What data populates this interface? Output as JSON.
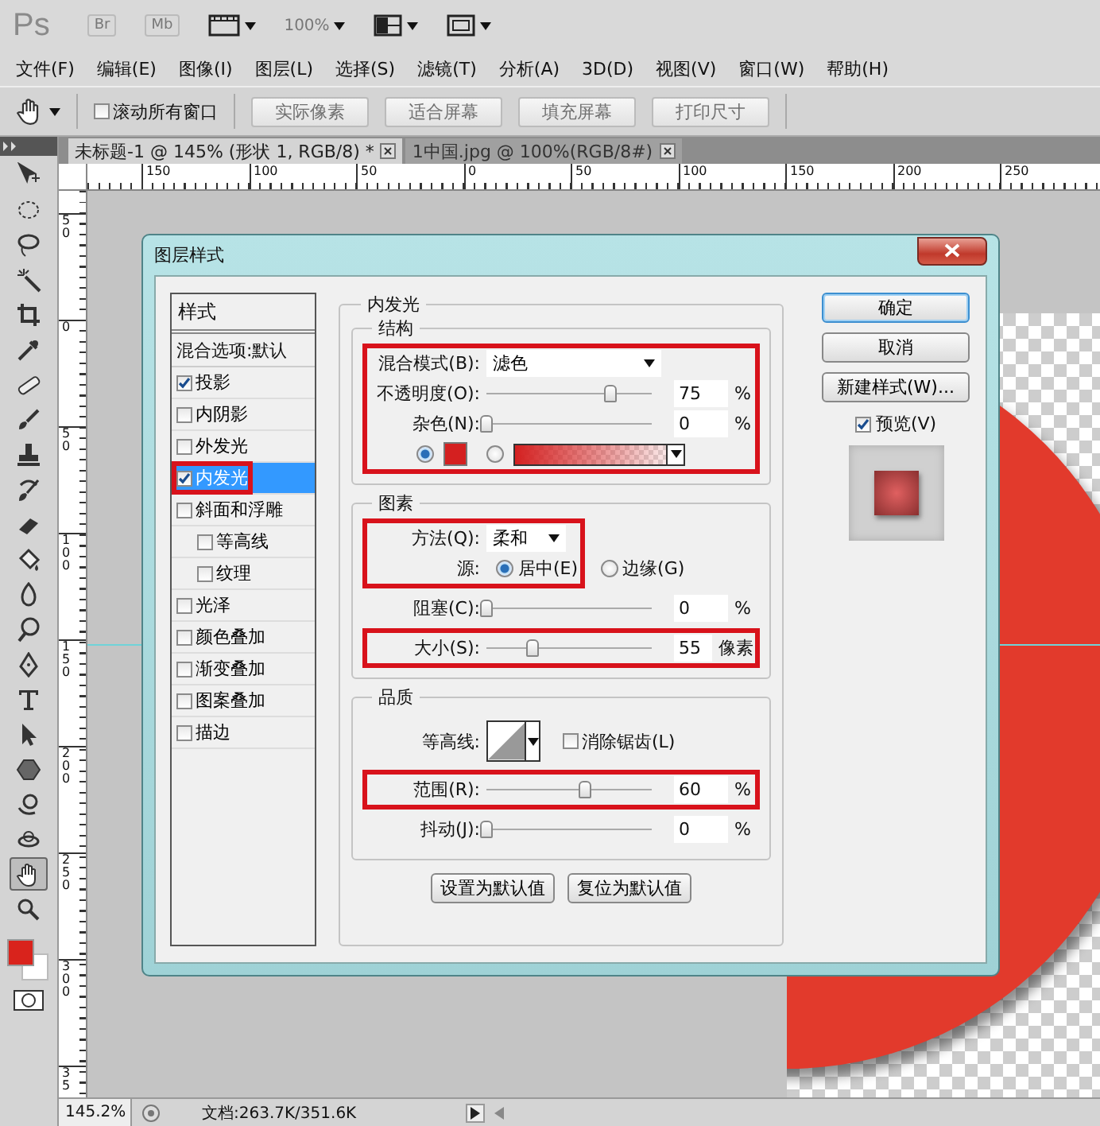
{
  "app_bar": {
    "logo": "Ps",
    "buttons": [
      {
        "label": "Br",
        "disabled": true
      },
      {
        "label": "Mb",
        "disabled": true
      }
    ],
    "zoom": {
      "value": "100%",
      "disabled": true
    }
  },
  "menu": [
    "文件(F)",
    "编辑(E)",
    "图像(I)",
    "图层(L)",
    "选择(S)",
    "滤镜(T)",
    "分析(A)",
    "3D(D)",
    "视图(V)",
    "窗口(W)",
    "帮助(H)"
  ],
  "options_bar": {
    "checkbox": {
      "label": "滚动所有窗口",
      "checked": false
    },
    "buttons": [
      {
        "label": "实际像素",
        "disabled": true
      },
      {
        "label": "适合屏幕",
        "disabled": true
      },
      {
        "label": "填充屏幕",
        "disabled": true
      },
      {
        "label": "打印尺寸",
        "disabled": true
      }
    ]
  },
  "doc_tabs": [
    {
      "title": "未标题-1 @ 145% (形状 1, RGB/8) *",
      "selected": true
    },
    {
      "title": "1中国.jpg @ 100%(RGB/8#)",
      "selected": false
    }
  ],
  "rulers": {
    "horizontal": [
      "150",
      "100",
      "50",
      "0",
      "50",
      "100",
      "150",
      "200",
      "250"
    ],
    "vertical": [
      "50",
      "0",
      "50",
      "100",
      "150",
      "200",
      "250",
      "300",
      "35"
    ]
  },
  "tools": [
    {
      "kind": "move",
      "selected": false
    },
    {
      "kind": "marquee",
      "selected": false
    },
    {
      "kind": "lasso",
      "selected": false
    },
    {
      "kind": "wand",
      "selected": false
    },
    {
      "kind": "crop",
      "selected": false
    },
    {
      "kind": "eyedropper",
      "selected": false
    },
    {
      "kind": "healing",
      "selected": false
    },
    {
      "kind": "brush",
      "selected": false
    },
    {
      "kind": "stamp",
      "selected": false
    },
    {
      "kind": "history",
      "selected": false
    },
    {
      "kind": "eraser",
      "selected": false
    },
    {
      "kind": "bucket",
      "selected": false
    },
    {
      "kind": "blur",
      "selected": false
    },
    {
      "kind": "dodge",
      "selected": false
    },
    {
      "kind": "pen",
      "selected": false
    },
    {
      "kind": "type",
      "selected": false
    },
    {
      "kind": "select",
      "selected": false
    },
    {
      "kind": "shape",
      "selected": false
    },
    {
      "kind": "rotate3d",
      "selected": false
    },
    {
      "kind": "orbit3d",
      "selected": false
    },
    {
      "kind": "hand",
      "selected": true
    },
    {
      "kind": "zoom",
      "selected": false
    }
  ],
  "dialog": {
    "title": "图层样式",
    "styles_header": "样式",
    "blend_options": "混合选项:默认",
    "styles": [
      {
        "label": "投影",
        "checked": true,
        "selected": false,
        "highlighted": false
      },
      {
        "label": "内阴影",
        "checked": false,
        "selected": false,
        "highlighted": false
      },
      {
        "label": "外发光",
        "checked": false,
        "selected": false,
        "highlighted": false
      },
      {
        "label": "内发光",
        "checked": true,
        "selected": true,
        "highlighted": true
      },
      {
        "label": "斜面和浮雕",
        "checked": false,
        "selected": false,
        "highlighted": false,
        "children": [
          {
            "label": "等高线",
            "checked": false,
            "selected": false,
            "highlighted": false
          },
          {
            "label": "纹理",
            "checked": false,
            "selected": false,
            "highlighted": false
          }
        ]
      },
      {
        "label": "光泽",
        "checked": false,
        "selected": false,
        "highlighted": false
      },
      {
        "label": "颜色叠加",
        "checked": false,
        "selected": false,
        "highlighted": false
      },
      {
        "label": "渐变叠加",
        "checked": false,
        "selected": false,
        "highlighted": false
      },
      {
        "label": "图案叠加",
        "checked": false,
        "selected": false,
        "highlighted": false
      },
      {
        "label": "描边",
        "checked": false,
        "selected": false,
        "highlighted": false
      }
    ],
    "panel_title": "内发光",
    "sections": [
      {
        "title": "结构",
        "blocks": [
          {
            "highlighted": true,
            "rows": [
              {
                "kind": "dropdown",
                "label": "混合模式(B):",
                "value": "滤色"
              },
              {
                "kind": "slider",
                "label": "不透明度(O):",
                "level": 0.75,
                "value": "75",
                "unit": "%"
              },
              {
                "kind": "slider",
                "label": "杂色(N):",
                "level": 0,
                "value": "0",
                "unit": "%"
              },
              {
                "kind": "color",
                "color": "#d42020",
                "solid_selected": true,
                "gradient_selected": false
              }
            ]
          }
        ]
      },
      {
        "title": "图素",
        "blocks": [
          {
            "highlighted": true,
            "rows": [
              {
                "kind": "dropdown",
                "label": "方法(Q):",
                "value": "柔和"
              },
              {
                "kind": "radio",
                "label": "源:",
                "options": [
                  {
                    "label": "居中(E)",
                    "selected": true
                  }
                ]
              }
            ]
          },
          {
            "highlighted": false,
            "rows": [
              {
                "kind": "radio",
                "options": [
                  {
                    "label": "边缘(G)",
                    "selected": false
                  }
                ]
              }
            ]
          },
          {
            "highlighted": false,
            "rows": [
              {
                "kind": "slider",
                "label": "阻塞(C):",
                "level": 0,
                "value": "0",
                "unit": "%"
              }
            ]
          },
          {
            "highlighted": true,
            "rows": [
              {
                "kind": "slider",
                "label": "大小(S):",
                "level": 0.28,
                "value": "55",
                "unit": "像素"
              }
            ]
          }
        ]
      },
      {
        "title": "品质",
        "blocks": [
          {
            "highlighted": false,
            "rows": [
              {
                "kind": "contour",
                "label": "等高线:",
                "checkbox": {
                  "label": "消除锯齿(L)",
                  "checked": false
                }
              }
            ]
          },
          {
            "highlighted": true,
            "rows": [
              {
                "kind": "slider",
                "label": "范围(R):",
                "level": 0.6,
                "value": "60",
                "unit": "%"
              }
            ]
          },
          {
            "highlighted": false,
            "rows": [
              {
                "kind": "slider",
                "label": "抖动(J):",
                "level": 0,
                "value": "0",
                "unit": "%"
              }
            ]
          }
        ]
      }
    ],
    "footer_buttons": [
      "设置为默认值",
      "复位为默认值"
    ],
    "side_buttons": [
      {
        "label": "确定",
        "default": true
      },
      {
        "label": "取消",
        "default": false
      },
      {
        "label": "新建样式(W)...",
        "default": false
      }
    ],
    "preview": {
      "label": "预览(V)",
      "checked": true
    }
  },
  "status_bar": {
    "zoom": "145.2%",
    "doc_info": "文档:263.7K/351.6K"
  }
}
